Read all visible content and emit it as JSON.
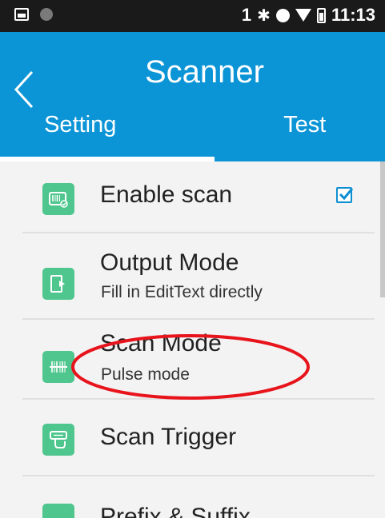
{
  "status_bar": {
    "sim_label": "1",
    "bluetooth_glyph": "✱",
    "time": "11:13"
  },
  "toolbar": {
    "title": "Scanner",
    "back_icon": "chevron-left-icon"
  },
  "tabs": [
    {
      "label": "Setting",
      "selected": true
    },
    {
      "label": "Test",
      "selected": false
    }
  ],
  "settings": [
    {
      "title": "Enable scan",
      "subtitle": "",
      "icon": "barcode-icon",
      "checked": true
    },
    {
      "title": "Output Mode",
      "subtitle": "Fill in EditText directly",
      "icon": "output-arrow-icon"
    },
    {
      "title": "Scan Mode",
      "subtitle": "Pulse mode",
      "icon": "scan-line-icon"
    },
    {
      "title": "Scan Trigger",
      "subtitle": "",
      "icon": "trigger-icon"
    },
    {
      "title": "Prefix & Suffix",
      "subtitle": "",
      "icon": "prefix-suffix-icon"
    }
  ],
  "colors": {
    "toolbar": "#0c95d6",
    "icon_bg": "#4fc68e",
    "annotation": "#e8141c",
    "checkbox": "#0c8fd2"
  }
}
